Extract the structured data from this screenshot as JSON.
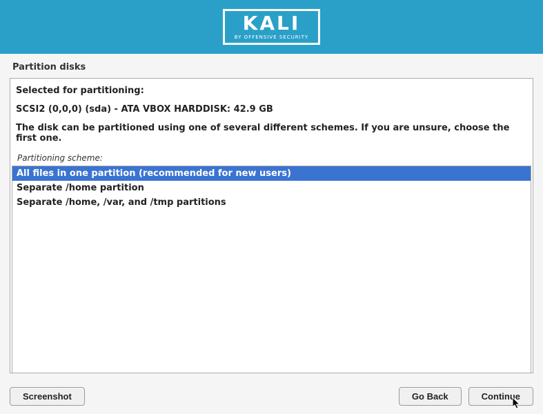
{
  "header": {
    "logo_text": "KALI",
    "logo_subtext": "BY OFFENSIVE SECURITY"
  },
  "page": {
    "title": "Partition disks"
  },
  "panel": {
    "selected_label": "Selected for partitioning:",
    "disk_info": "SCSI2 (0,0,0) (sda) - ATA VBOX HARDDISK: 42.9 GB",
    "instruction": "The disk can be partitioned using one of several different schemes. If you are unsure, choose the first one.",
    "scheme_label": "Partitioning scheme:"
  },
  "options": [
    {
      "label": "All files in one partition (recommended for new users)",
      "selected": true
    },
    {
      "label": "Separate /home partition",
      "selected": false
    },
    {
      "label": "Separate /home, /var, and /tmp partitions",
      "selected": false
    }
  ],
  "buttons": {
    "screenshot": "Screenshot",
    "go_back": "Go Back",
    "continue": "Continue"
  }
}
